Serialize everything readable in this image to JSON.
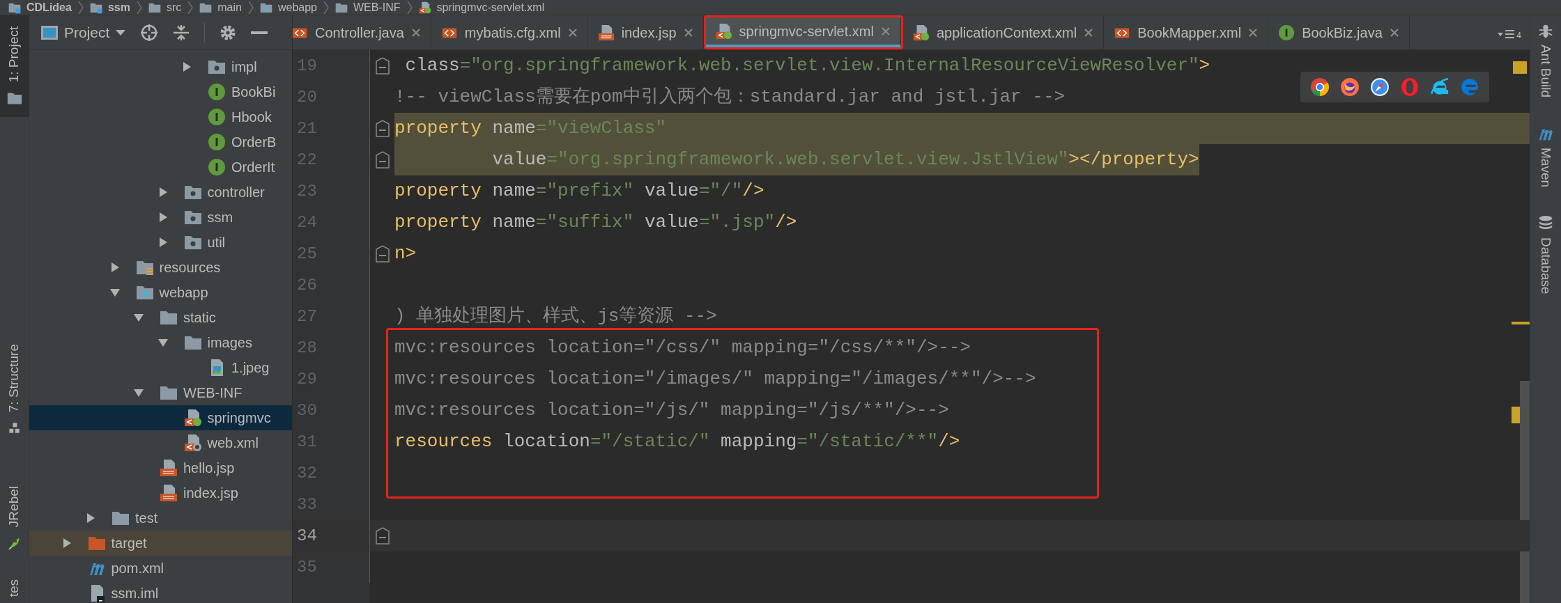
{
  "breadcrumb": [
    {
      "label": "CDLidea",
      "kind": "module"
    },
    {
      "label": "ssm",
      "kind": "module"
    },
    {
      "label": "src",
      "kind": "folder"
    },
    {
      "label": "main",
      "kind": "folder"
    },
    {
      "label": "webapp",
      "kind": "web-folder"
    },
    {
      "label": "WEB-INF",
      "kind": "folder"
    },
    {
      "label": "springmvc-servlet.xml",
      "kind": "spring-xml"
    }
  ],
  "left_toolbar": [
    {
      "label": "1: Project",
      "kind": "folder",
      "selected": true
    },
    {
      "label": "7: Structure",
      "kind": "structure",
      "selected": false
    },
    {
      "label": "JRebel",
      "kind": "rocket",
      "selected": false
    },
    {
      "label": "tes",
      "kind": "none",
      "selected": false
    }
  ],
  "project_panel": {
    "title": "Project",
    "tree": [
      {
        "children": [
          {
            "children": [
              {
                "children": [
                  {
                    "children": [
                      {
                        "children": [
                          {
                            "label": "impl",
                            "kind": "package",
                            "expanded": false,
                            "selected": false
                          },
                          {
                            "label": "BookBi",
                            "kind": "interface",
                            "selected": false
                          },
                          {
                            "label": "Hbook",
                            "kind": "interface",
                            "selected": false
                          },
                          {
                            "label": "OrderB",
                            "kind": "interface",
                            "selected": false
                          },
                          {
                            "label": "OrderIt",
                            "kind": "interface",
                            "selected": false
                          }
                        ]
                      },
                      {
                        "label": "controller",
                        "kind": "package",
                        "expanded": false,
                        "selected": false
                      },
                      {
                        "label": "ssm",
                        "kind": "package",
                        "expanded": false,
                        "selected": false
                      },
                      {
                        "label": "util",
                        "kind": "package",
                        "expanded": false,
                        "selected": false
                      }
                    ]
                  }
                ]
              },
              {
                "label": "resources",
                "kind": "resources-folder",
                "expanded": false,
                "selected": false
              },
              {
                "label": "webapp",
                "kind": "web-folder",
                "expanded": true,
                "selected": false,
                "children": [
                  {
                    "label": "static",
                    "kind": "folder",
                    "expanded": true,
                    "selected": false,
                    "children": [
                      {
                        "label": "images",
                        "kind": "folder",
                        "expanded": true,
                        "selected": false,
                        "children": [
                          {
                            "label": "1.jpeg",
                            "kind": "image",
                            "selected": false
                          }
                        ]
                      }
                    ]
                  },
                  {
                    "label": "WEB-INF",
                    "kind": "folder",
                    "expanded": true,
                    "selected": false,
                    "children": [
                      {
                        "label": "springmvc",
                        "kind": "spring-xml",
                        "selected": true
                      },
                      {
                        "label": "web.xml",
                        "kind": "web-xml",
                        "selected": false
                      }
                    ]
                  },
                  {
                    "label": "hello.jsp",
                    "kind": "jsp",
                    "selected": false
                  },
                  {
                    "label": "index.jsp",
                    "kind": "jsp",
                    "selected": false
                  }
                ]
              }
            ]
          },
          {
            "label": "test",
            "kind": "folder",
            "expanded": false,
            "selected": false
          }
        ]
      },
      {
        "label": "target",
        "kind": "excluded-folder",
        "expanded": false,
        "selected": false
      },
      {
        "label": "pom.xml",
        "kind": "maven",
        "selected": false
      },
      {
        "label": "ssm.iml",
        "kind": "iml",
        "selected": false
      }
    ]
  },
  "tabs": [
    {
      "label": "Controller.java",
      "kind": "xml",
      "selected": false,
      "boxed": false
    },
    {
      "label": "mybatis.cfg.xml",
      "kind": "xml",
      "selected": false,
      "boxed": false
    },
    {
      "label": "index.jsp",
      "kind": "jsp",
      "selected": false,
      "boxed": false
    },
    {
      "label": "springmvc-servlet.xml",
      "kind": "spring-xml",
      "selected": true,
      "boxed": true
    },
    {
      "label": "applicationContext.xml",
      "kind": "spring-xml",
      "selected": false,
      "boxed": false
    },
    {
      "label": "BookMapper.xml",
      "kind": "xml",
      "selected": false,
      "boxed": false
    },
    {
      "label": "BookBiz.java",
      "kind": "interface",
      "selected": false,
      "boxed": false
    }
  ],
  "tab_overflow": {
    "count": "4"
  },
  "code_blocks": [
    {
      "boxed": false,
      "lines": [
        {
          "number": "19",
          "fold": true,
          "highlighted": false,
          "current": false,
          "tokens": [
            {
              "kind": "attr",
              "text": " class"
            },
            {
              "kind": "value",
              "text": "=\"org.springframework.web.servlet.view.InternalResourceViewResolver\""
            },
            {
              "kind": "tag",
              "text": ">"
            }
          ]
        },
        {
          "number": "20",
          "fold": false,
          "highlighted": false,
          "current": false,
          "tokens": [
            {
              "kind": "comment",
              "text": "!-- viewClass需要在pom中引入两个包：standard.jar and jstl.jar -->"
            }
          ]
        },
        {
          "number": "21",
          "fold": true,
          "highlighted": true,
          "current": false,
          "tokens": [
            {
              "kind": "tag",
              "text": "property"
            },
            {
              "kind": "attr",
              "text": " name"
            },
            {
              "kind": "value",
              "text": "=\"viewClass\""
            }
          ]
        },
        {
          "number": "22",
          "fold": true,
          "highlighted": true,
          "current": false,
          "tokens": [
            {
              "kind": "attr",
              "text": "         value"
            },
            {
              "kind": "value",
              "text": "=\"org.springframework.web.servlet.view.JstlView\""
            },
            {
              "kind": "tag",
              "text": "></property>"
            }
          ]
        },
        {
          "number": "23",
          "fold": false,
          "highlighted": false,
          "current": false,
          "tokens": [
            {
              "kind": "tag",
              "text": "property"
            },
            {
              "kind": "attr",
              "text": " name"
            },
            {
              "kind": "value",
              "text": "=\"prefix\""
            },
            {
              "kind": "attr",
              "text": " value"
            },
            {
              "kind": "value",
              "text": "=\"/\""
            },
            {
              "kind": "tag",
              "text": "/>"
            }
          ]
        },
        {
          "number": "24",
          "fold": false,
          "highlighted": false,
          "current": false,
          "tokens": [
            {
              "kind": "tag",
              "text": "property"
            },
            {
              "kind": "attr",
              "text": " name"
            },
            {
              "kind": "value",
              "text": "=\"suffix\""
            },
            {
              "kind": "attr",
              "text": " value"
            },
            {
              "kind": "value",
              "text": "=\".jsp\""
            },
            {
              "kind": "tag",
              "text": "/>"
            }
          ]
        },
        {
          "number": "25",
          "fold": true,
          "highlighted": false,
          "current": false,
          "tokens": [
            {
              "kind": "tag",
              "text": "n>"
            }
          ]
        },
        {
          "number": "26",
          "fold": false,
          "highlighted": false,
          "current": false
        },
        {
          "number": "27",
          "fold": false,
          "highlighted": false,
          "current": false,
          "tokens": [
            {
              "kind": "comment",
              "text": ") 单独处理图片、样式、js等资源 -->"
            }
          ]
        }
      ]
    },
    {
      "boxed": true,
      "lines": [
        {
          "number": "28",
          "fold": false,
          "highlighted": false,
          "current": false,
          "tokens": [
            {
              "kind": "comment",
              "text": "mvc:resources location=\"/css/\" mapping=\"/css/**\"/>-->"
            }
          ]
        },
        {
          "number": "29",
          "fold": false,
          "highlighted": false,
          "current": false,
          "tokens": [
            {
              "kind": "comment",
              "text": "mvc:resources location=\"/images/\" mapping=\"/images/**\"/>-->"
            }
          ]
        },
        {
          "number": "30",
          "fold": false,
          "highlighted": false,
          "current": false,
          "tokens": [
            {
              "kind": "comment",
              "text": "mvc:resources location=\"/js/\" mapping=\"/js/**\"/>-->"
            }
          ]
        },
        {
          "number": "31",
          "fold": false,
          "highlighted": false,
          "current": false,
          "tokens": [
            {
              "kind": "tag",
              "text": "resources"
            },
            {
              "kind": "attr",
              "text": " location"
            },
            {
              "kind": "value",
              "text": "=\"/static/\""
            },
            {
              "kind": "attr",
              "text": " mapping"
            },
            {
              "kind": "value",
              "text": "=\"/static/**\""
            },
            {
              "kind": "tag",
              "text": "/>"
            }
          ]
        },
        {
          "number": "32",
          "fold": false,
          "highlighted": false,
          "current": false
        }
      ]
    },
    {
      "boxed": false,
      "lines": [
        {
          "number": "33",
          "fold": false,
          "highlighted": false,
          "current": false
        },
        {
          "number": "34",
          "fold": true,
          "highlighted": false,
          "current": true
        },
        {
          "number": "35",
          "fold": false,
          "highlighted": false,
          "current": false
        }
      ]
    }
  ],
  "browser_bar": [
    {
      "kind": "chrome"
    },
    {
      "kind": "firefox"
    },
    {
      "kind": "safari"
    },
    {
      "kind": "opera"
    },
    {
      "kind": "ie"
    },
    {
      "kind": "edge"
    }
  ],
  "right_toolbar": [
    {
      "label": "Ant Build",
      "kind": "ant"
    },
    {
      "label": "Maven",
      "kind": "maven"
    },
    {
      "label": "Database",
      "kind": "database"
    }
  ]
}
